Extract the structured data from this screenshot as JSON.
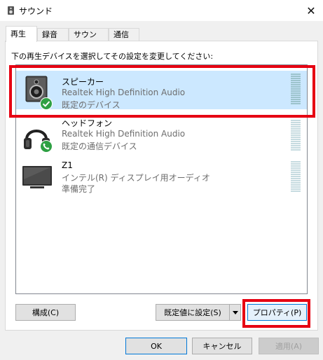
{
  "window": {
    "title": "サウンド",
    "close_glyph": "✕"
  },
  "tabs": [
    {
      "label": "再生"
    },
    {
      "label": "録音"
    },
    {
      "label": "サウンド"
    },
    {
      "label": "通信"
    }
  ],
  "instruction": "下の再生デバイスを選択してその設定を変更してください:",
  "devices": [
    {
      "name": "スピーカー",
      "driver": "Realtek High Definition Audio",
      "status": "既定のデバイス",
      "icon": "speaker-icon",
      "badge": "check-badge-icon",
      "selected": true
    },
    {
      "name": "ヘッドフォン",
      "driver": "Realtek High Definition Audio",
      "status": "既定の通信デバイス",
      "icon": "headphones-icon",
      "badge": "phone-badge-icon",
      "selected": false
    },
    {
      "name": "Z1",
      "driver": "インテル(R) ディスプレイ用オーディオ",
      "status": "準備完了",
      "icon": "monitor-icon",
      "selected": false
    }
  ],
  "buttons": {
    "configure": "構成(C)",
    "set_default": "既定値に設定(S)",
    "properties": "プロパティ(P)",
    "ok": "OK",
    "cancel": "キャンセル",
    "apply": "適用(A)"
  },
  "colors": {
    "selection": "#cce8ff",
    "highlight": "#e60012",
    "badge_green": "#2ea043",
    "focus_blue": "#0078d7"
  }
}
